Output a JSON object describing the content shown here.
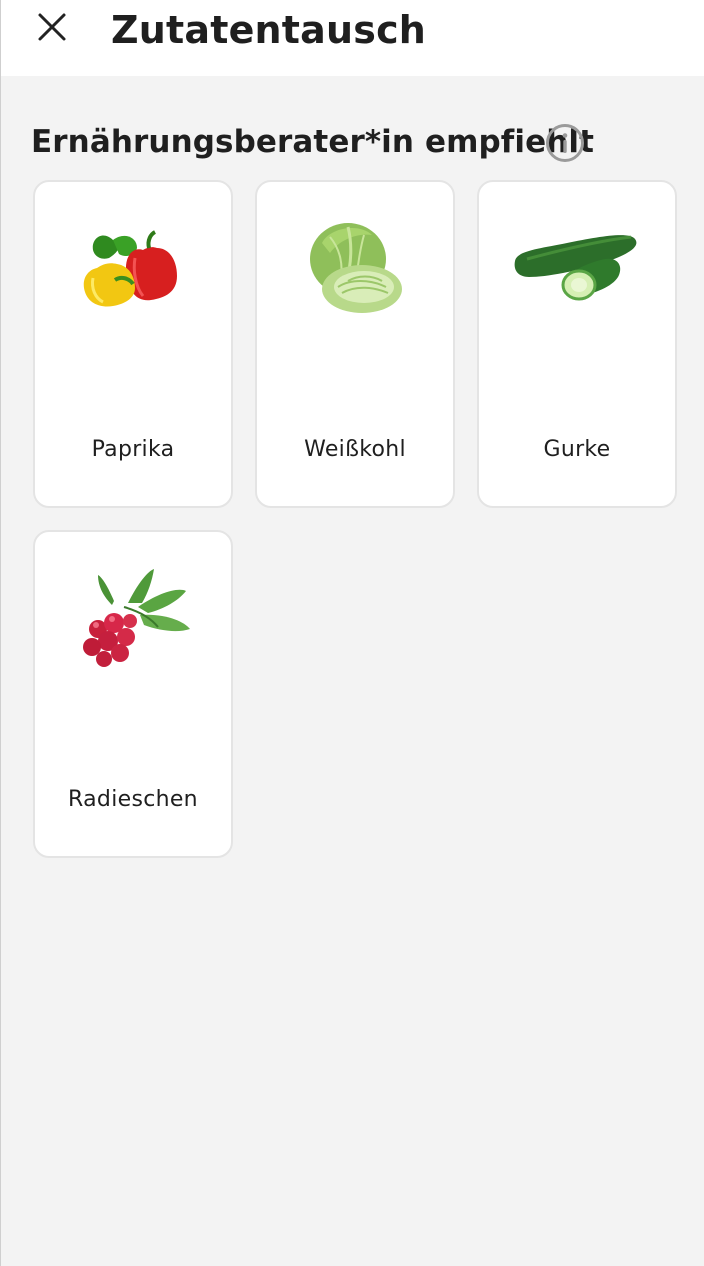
{
  "header": {
    "title": "Zutatentausch",
    "close_icon": "close-icon"
  },
  "section": {
    "title": "Ernährungsberater*in empfiehlt",
    "info_icon": "info-icon"
  },
  "items": [
    {
      "label": "Paprika",
      "image": "paprika-image"
    },
    {
      "label": "Weißkohl",
      "image": "cabbage-image"
    },
    {
      "label": "Gurke",
      "image": "cucumber-image"
    },
    {
      "label": "Radieschen",
      "image": "radish-image"
    }
  ],
  "colors": {
    "background": "#f3f3f3",
    "card": "#ffffff",
    "card_border": "#e4e4e4",
    "text": "#1f1f1f",
    "info_icon": "#9a9a9a"
  }
}
